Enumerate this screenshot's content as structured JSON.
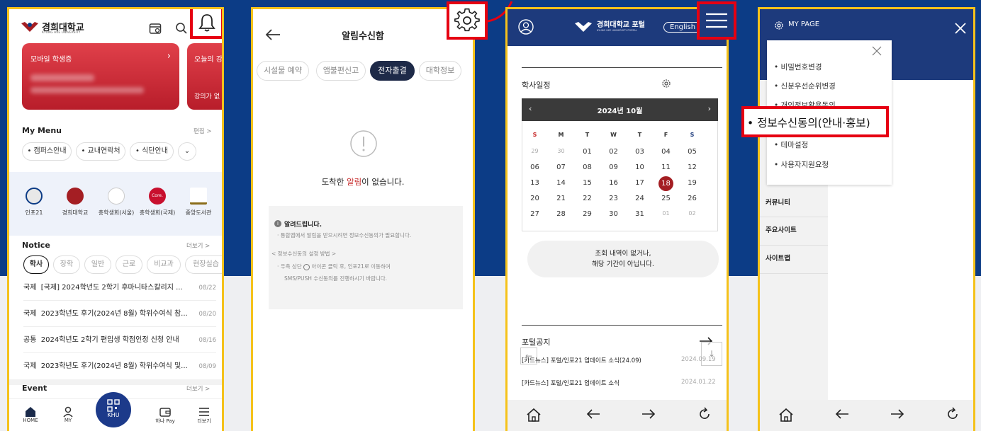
{
  "phone1": {
    "header": {
      "logo_text": "경희대학교",
      "logo_sub": "KYUNG HEE UNIVERSITY"
    },
    "card_student": {
      "label": "모바일 학생증"
    },
    "card_today": {
      "label": "오늘의 강",
      "sub": "강의가 없"
    },
    "my_menu": {
      "title": "My Menu",
      "edit": "편집 >",
      "chips": [
        "• 캠퍼스안내",
        "• 교내연락처",
        "• 식단안내"
      ]
    },
    "quick_icons": [
      {
        "label": "인포21",
        "icon": "info21-icon"
      },
      {
        "label": "경희대학교",
        "icon": "khu-emblem-icon"
      },
      {
        "label": "총학생회(서울)",
        "icon": "student-council-seoul-icon"
      },
      {
        "label": "총학생회(국제)",
        "icon": "student-council-global-icon",
        "badge": "Core."
      },
      {
        "label": "중앙도서관",
        "icon": "library-icon"
      }
    ],
    "notice": {
      "title": "Notice",
      "more": "더보기 >",
      "tabs": [
        "학사",
        "장학",
        "일반",
        "근로",
        "비교과",
        "현장실습"
      ],
      "rows": [
        {
          "cat": "국제",
          "title": "[국제] 2024학년도 2학기 후마니타스칼리지 ...",
          "date": "08/22"
        },
        {
          "cat": "국제",
          "title": "2023학년도 후기(2024년 8월) 학위수여식 참...",
          "date": "08/20"
        },
        {
          "cat": "공통",
          "title": "2024학년도 2학기 편입생 학점인정 신청 안내",
          "date": "08/16"
        },
        {
          "cat": "국제",
          "title": "2023학년도 후기(2024년 8월) 학위수여식 및...",
          "date": "08/09"
        }
      ]
    },
    "event": {
      "title": "Event",
      "more": "더보기 >"
    },
    "bottom_nav": [
      {
        "label": "HOME",
        "icon": "home-icon"
      },
      {
        "label": "MY",
        "icon": "person-icon"
      },
      {
        "label": "KHU",
        "icon": "qr-icon"
      },
      {
        "label": "하나 Pay",
        "icon": "wallet-icon"
      },
      {
        "label": "더보기",
        "icon": "menu-icon"
      }
    ]
  },
  "phone2": {
    "title": "알림수신함",
    "tabs": [
      "시설물 예약",
      "앱불편신고",
      "전자출결",
      "대학정보"
    ],
    "active_tab": "전자출결",
    "empty_pre": "도착한 ",
    "empty_hl": "알림",
    "empty_post": "이 없습니다.",
    "info_title": "알려드립니다.",
    "info_line1": "· 통합앱에서 알림을 받으시려면 정보수신동의가 필요합니다.",
    "info_line2": "< 정보수신동의 설정 방법 >",
    "info_line3a": "· 우측 상단",
    "info_line3b": "아이콘 클릭 후, 인포21로 이동하여",
    "info_line4": "SMS/PUSH 수신동의를 진행하시기 바랍니다."
  },
  "phone3": {
    "header_title": "경희대학교 포털",
    "header_sub": "KYUNG HEE UNIVERSITY PORTAL",
    "lang": "English",
    "schedule_title": "학사일정",
    "month": "2024년 10월",
    "weekdays": [
      "S",
      "M",
      "T",
      "W",
      "T",
      "F",
      "S"
    ],
    "weeks": [
      [
        "29",
        "30",
        "01",
        "02",
        "03",
        "04",
        "05"
      ],
      [
        "06",
        "07",
        "08",
        "09",
        "10",
        "11",
        "12"
      ],
      [
        "13",
        "14",
        "15",
        "16",
        "17",
        "18",
        "19"
      ],
      [
        "20",
        "21",
        "22",
        "23",
        "24",
        "25",
        "26"
      ],
      [
        "27",
        "28",
        "29",
        "30",
        "31",
        "01",
        "02"
      ]
    ],
    "selected_day": "18",
    "empty_line1": "조회 내역이 없거나,",
    "empty_line2": "해당 기간이 아닙니다.",
    "portal_notice_title": "포털공지",
    "portal_notices": [
      {
        "title": "[카드뉴스] 포털/인포21 업데이트 소식(24.09)",
        "date": "2024.09.19"
      },
      {
        "title": "[카드뉴스] 포털/인포21 업데이트 소식",
        "date": "2024.01.22"
      }
    ]
  },
  "phone4": {
    "mypage": "MY PAGE",
    "menu_items": [
      "• 비밀번호변경",
      "• 신분우선순위변경",
      "• 개인정보활용동의",
      "• 테마설정",
      "• 사용자지원요청"
    ],
    "highlight_item": "• 정보수신동의(안내·홍보)",
    "side_items": [
      "커뮤니티",
      "주요사이트",
      "사이트맵"
    ]
  },
  "colors": {
    "brand_blue": "#0c3c86",
    "brand_red": "#a41e23",
    "highlight_box": "#e60012",
    "frame": "#f5c21b"
  }
}
